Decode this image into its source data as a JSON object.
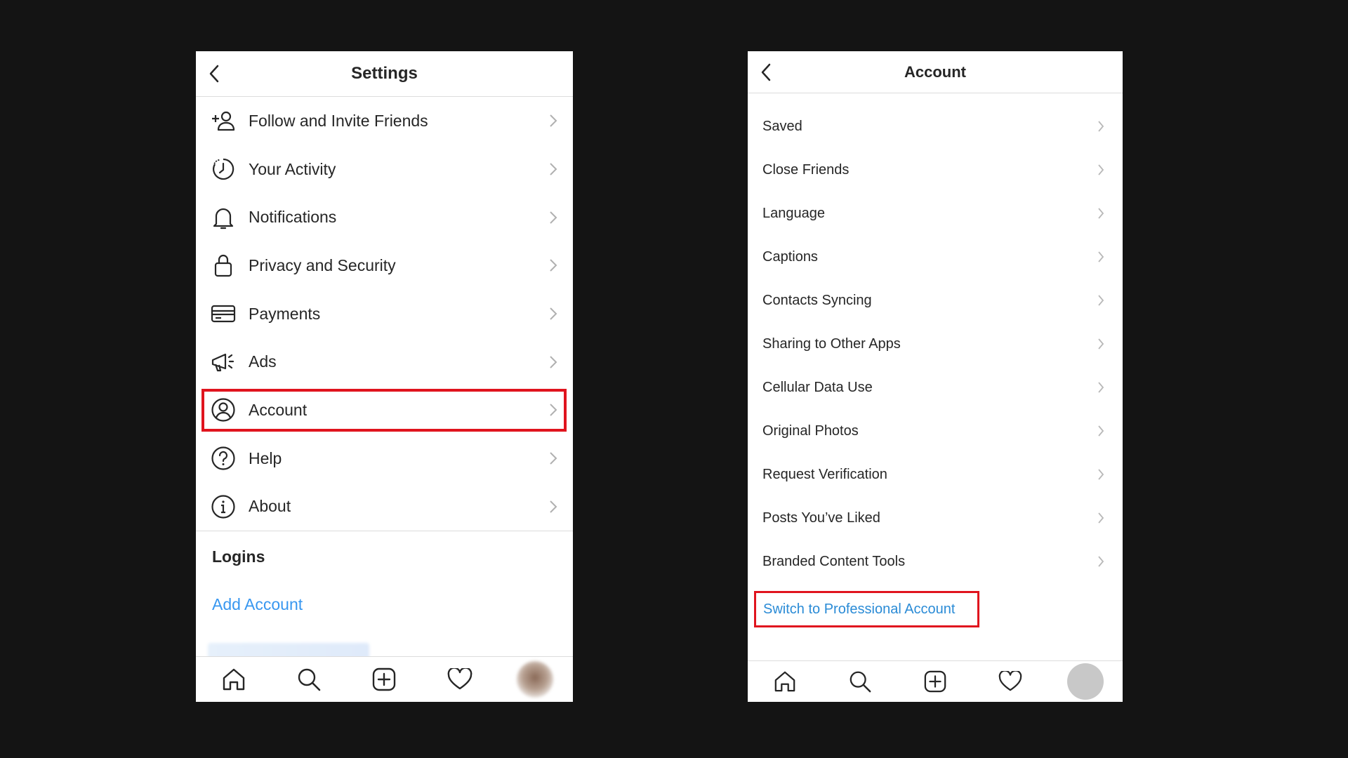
{
  "left": {
    "header": {
      "title": "Settings"
    },
    "items": [
      {
        "label": "Follow and Invite Friends",
        "icon": "add-friend-icon"
      },
      {
        "label": "Your Activity",
        "icon": "activity-icon"
      },
      {
        "label": "Notifications",
        "icon": "bell-icon"
      },
      {
        "label": "Privacy and Security",
        "icon": "lock-icon"
      },
      {
        "label": "Payments",
        "icon": "card-icon"
      },
      {
        "label": "Ads",
        "icon": "megaphone-icon"
      },
      {
        "label": "Account",
        "icon": "account-icon"
      },
      {
        "label": "Help",
        "icon": "help-icon"
      },
      {
        "label": "About",
        "icon": "info-icon"
      }
    ],
    "logins": {
      "title": "Logins",
      "add_account": "Add Account"
    }
  },
  "right": {
    "header": {
      "title": "Account"
    },
    "items": [
      {
        "label": "Saved"
      },
      {
        "label": "Close Friends"
      },
      {
        "label": "Language"
      },
      {
        "label": "Captions"
      },
      {
        "label": "Contacts Syncing"
      },
      {
        "label": "Sharing to Other Apps"
      },
      {
        "label": "Cellular Data Use"
      },
      {
        "label": "Original Photos"
      },
      {
        "label": "Request Verification"
      },
      {
        "label": "Posts You’ve Liked"
      },
      {
        "label": "Branded Content Tools"
      }
    ],
    "switch_link": "Switch to Professional Account"
  },
  "colors": {
    "highlight": "#e0141e",
    "link": "#3897f0",
    "background": "#141414"
  }
}
